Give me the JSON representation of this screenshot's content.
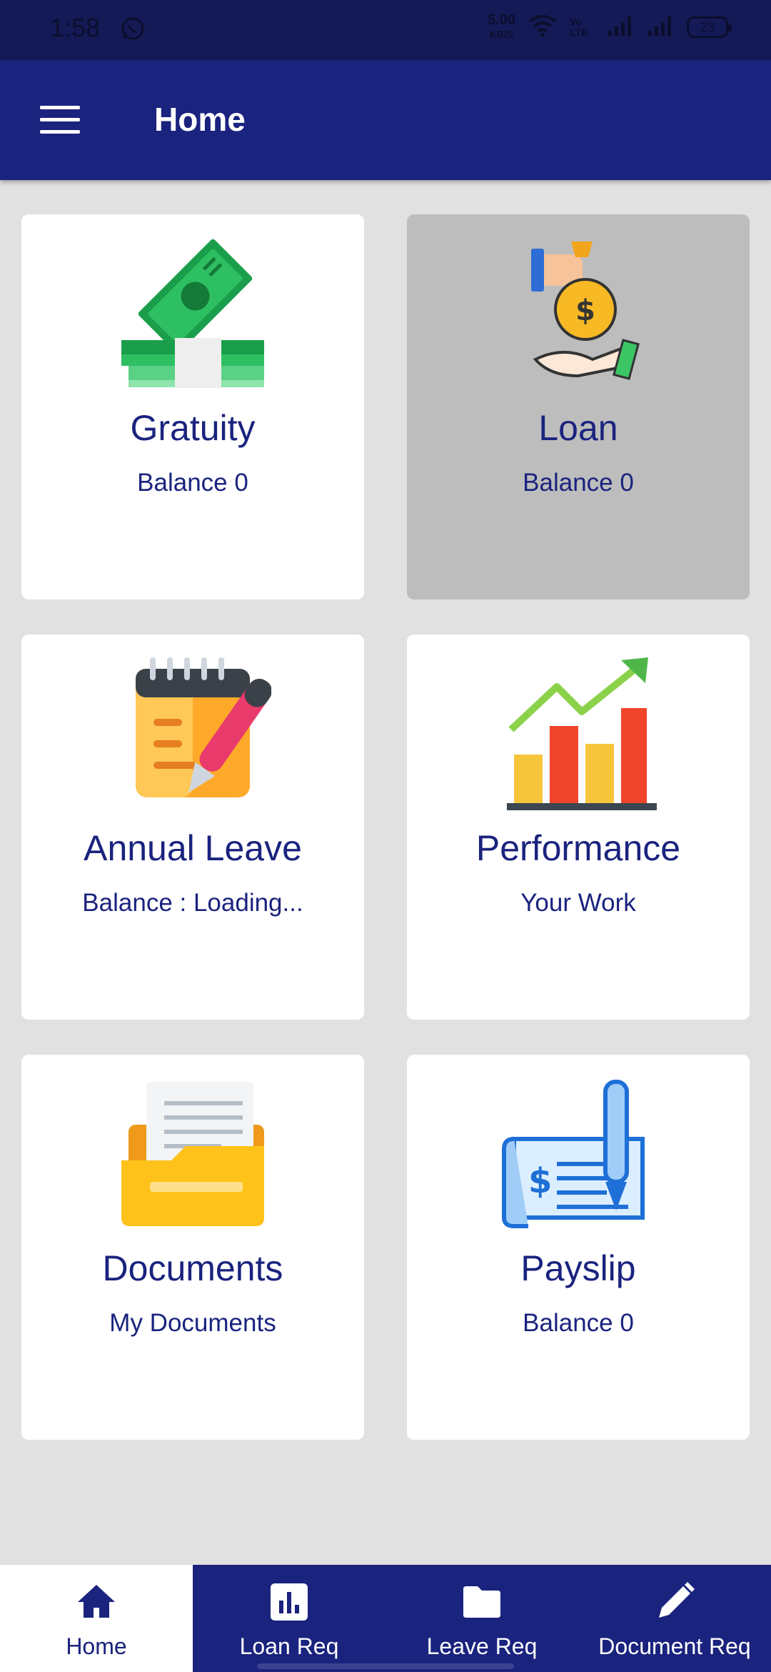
{
  "status_bar": {
    "time": "1:58",
    "net_speed": "5.00",
    "net_unit": "KB/S",
    "volte": "Vo LTE",
    "battery": "23"
  },
  "app_bar": {
    "title": "Home",
    "menu_icon": "hamburger-menu-icon"
  },
  "cards": [
    {
      "title": "Gratuity",
      "subtitle": "Balance 0",
      "icon": "cash-money-icon",
      "selected": false
    },
    {
      "title": "Loan",
      "subtitle": "Balance 0",
      "icon": "money-bag-hand-icon",
      "selected": true
    },
    {
      "title": "Annual Leave",
      "subtitle": "Balance : Loading...",
      "icon": "notepad-pen-icon",
      "selected": false
    },
    {
      "title": "Performance",
      "subtitle": "Your Work",
      "icon": "growth-chart-icon",
      "selected": false
    },
    {
      "title": "Documents",
      "subtitle": "My Documents",
      "icon": "document-folder-icon",
      "selected": false
    },
    {
      "title": "Payslip",
      "subtitle": "Balance 0",
      "icon": "cheque-pen-icon",
      "selected": false
    }
  ],
  "bottom_nav": {
    "items": [
      {
        "label": "Home",
        "icon": "home-icon",
        "active": true
      },
      {
        "label": "Loan Req",
        "icon": "bar-chart-icon",
        "active": false
      },
      {
        "label": "Leave Req",
        "icon": "folder-icon",
        "active": false
      },
      {
        "label": "Document Req",
        "icon": "pencil-icon",
        "active": false
      }
    ]
  },
  "colors": {
    "primary": "#1a237e",
    "status_bar": "#141a55",
    "background": "#e1e1e1",
    "card": "#ffffff",
    "card_selected": "#bdbdbd"
  }
}
